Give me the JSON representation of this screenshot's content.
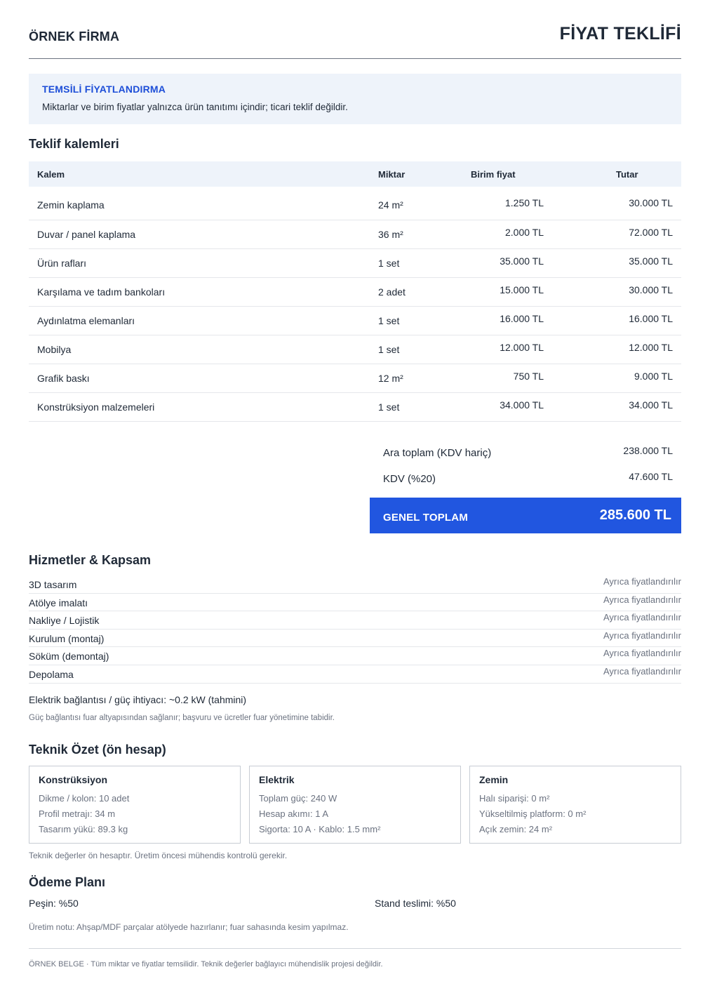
{
  "header": {
    "company": "ÖRNEK FİRMA",
    "title": "FİYAT TEKLİFİ"
  },
  "notice": {
    "title": "TEMSİLİ FİYATLANDIRMA",
    "text": "Miktarlar ve birim fiyatlar yalnızca ürün tanıtımı içindir; ticari teklif değildir."
  },
  "items_section": {
    "title": "Teklif kalemleri",
    "columns": [
      "Kalem",
      "Miktar",
      "Birim fiyat",
      "Tutar"
    ],
    "rows": [
      {
        "name": "Zemin kaplama",
        "qty": "24 m²",
        "unit": "1.250 TL",
        "total": "30.000 TL"
      },
      {
        "name": "Duvar / panel kaplama",
        "qty": "36 m²",
        "unit": "2.000 TL",
        "total": "72.000 TL"
      },
      {
        "name": "Ürün rafları",
        "qty": "1 set",
        "unit": "35.000 TL",
        "total": "35.000 TL"
      },
      {
        "name": "Karşılama ve tadım bankoları",
        "qty": "2 adet",
        "unit": "15.000 TL",
        "total": "30.000 TL"
      },
      {
        "name": "Aydınlatma elemanları",
        "qty": "1 set",
        "unit": "16.000 TL",
        "total": "16.000 TL"
      },
      {
        "name": "Mobilya",
        "qty": "1 set",
        "unit": "12.000 TL",
        "total": "12.000 TL"
      },
      {
        "name": "Grafik baskı",
        "qty": "12 m²",
        "unit": "750 TL",
        "total": "9.000 TL"
      },
      {
        "name": "Konstrüksiyon malzemeleri",
        "qty": "1 set",
        "unit": "34.000 TL",
        "total": "34.000 TL"
      }
    ]
  },
  "totals": {
    "subtotal_label": "Ara toplam (KDV hariç)",
    "subtotal_value": "238.000 TL",
    "vat_label": "KDV (%20)",
    "vat_value": "47.600 TL",
    "grand_label": "GENEL TOPLAM",
    "grand_value": "285.600 TL"
  },
  "services": {
    "title": "Hizmetler & Kapsam",
    "items": [
      {
        "name": "3D tasarım",
        "value": "Ayrıca fiyatlandırılır"
      },
      {
        "name": "Atölye imalatı",
        "value": "Ayrıca fiyatlandırılır"
      },
      {
        "name": "Nakliye / Lojistik",
        "value": "Ayrıca fiyatlandırılır"
      },
      {
        "name": "Kurulum (montaj)",
        "value": "Ayrıca fiyatlandırılır"
      },
      {
        "name": "Söküm (demontaj)",
        "value": "Ayrıca fiyatlandırılır"
      },
      {
        "name": "Depolama",
        "value": "Ayrıca fiyatlandırılır"
      }
    ],
    "power": "Elektrik bağlantısı / güç ihtiyacı: ~0.2 kW (tahmini)",
    "power_note": "Güç bağlantısı fuar altyapısından sağlanır; başvuru ve ücretler fuar yönetimine tabidir."
  },
  "technical": {
    "title": "Teknik Özet (ön hesap)",
    "cards": [
      {
        "title": "Konstrüksiyon",
        "lines": [
          "Dikme / kolon: 10 adet",
          "Profil metrajı: 34 m",
          "Tasarım yükü: 89.3 kg"
        ]
      },
      {
        "title": "Elektrik",
        "lines": [
          "Toplam güç: 240 W",
          "Hesap akımı: 1 A",
          "Sigorta: 10 A · Kablo: 1.5 mm²"
        ]
      },
      {
        "title": "Zemin",
        "lines": [
          "Halı siparişi: 0 m²",
          "Yükseltilmiş platform: 0 m²",
          "Açık zemin: 24 m²"
        ]
      }
    ],
    "note": "Teknik değerler ön hesaptır. Üretim öncesi mühendis kontrolü gerekir."
  },
  "payment": {
    "title": "Ödeme Planı",
    "advance": "Peşin: %50",
    "delivery": "Stand teslimi: %50",
    "production_note": "Üretim notu: Ahşap/MDF parçalar atölyede hazırlanır; fuar sahasında kesim yapılmaz."
  },
  "footer": "ÖRNEK BELGE · Tüm miktar ve fiyatlar temsilidir. Teknik değerler bağlayıcı mühendislik projesi değildir.",
  "colors": {
    "accent": "#2156e0",
    "notice_bg": "#eef3fa",
    "notice_title": "#1d4ed8"
  }
}
